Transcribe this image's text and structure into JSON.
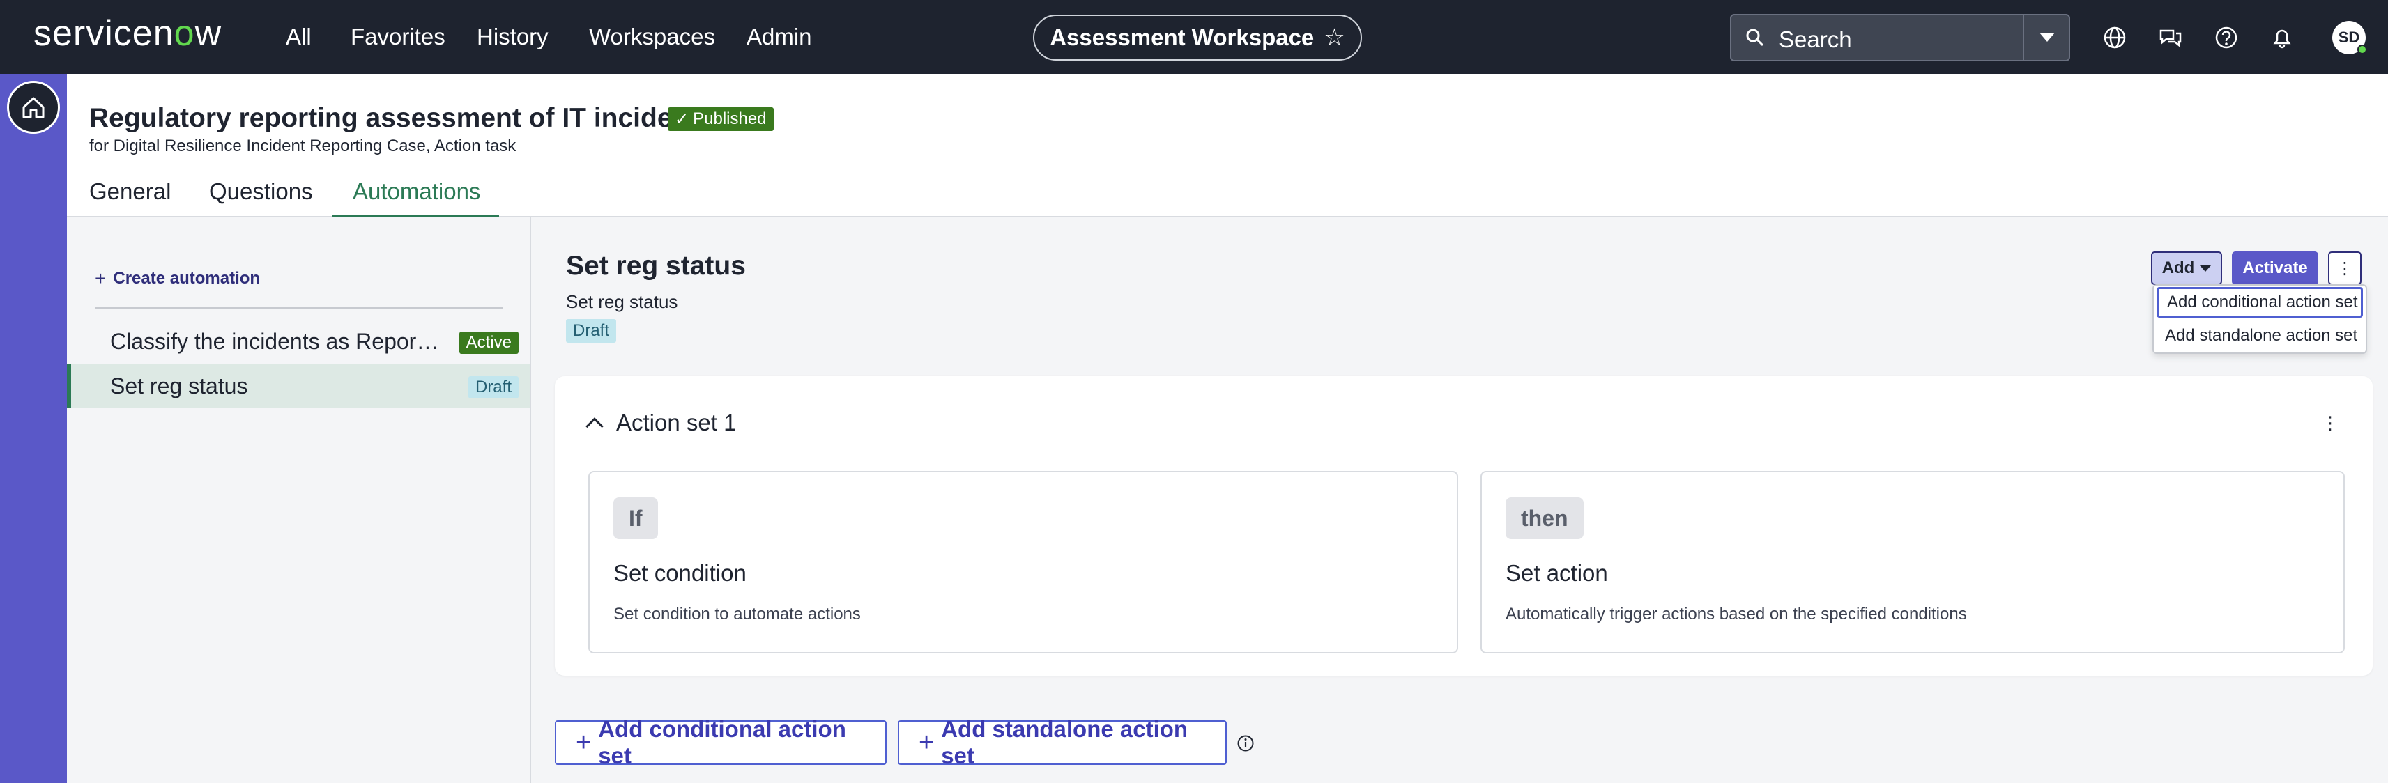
{
  "topnav": {
    "logo_pre": "servicen",
    "logo_o": "o",
    "logo_post": "w",
    "items": [
      "All",
      "Favorites",
      "History",
      "Workspaces",
      "Admin"
    ],
    "workspace_label": "Assessment Workspace",
    "search_placeholder": "Search",
    "avatar_initials": "SD"
  },
  "header": {
    "title": "Regulatory reporting assessment of IT incidents",
    "status_badge": "Published",
    "subtitle": "for Digital Resilience Incident Reporting Case, Action task",
    "tabs": [
      "General",
      "Questions",
      "Automations"
    ],
    "active_tab": "Automations"
  },
  "sidebar": {
    "create_label": "Create automation",
    "items": [
      {
        "name": "Classify the incidents as Repor…",
        "status": "Active"
      },
      {
        "name": "Set reg status",
        "status": "Draft"
      }
    ]
  },
  "main": {
    "title": "Set reg status",
    "subtitle": "Set reg status",
    "status": "Draft",
    "add_label": "Add",
    "activate_label": "Activate",
    "dropdown": [
      "Add conditional action set",
      "Add standalone action set"
    ],
    "action_set": {
      "title": "Action set 1",
      "if_pill": "If",
      "if_title": "Set condition",
      "if_desc": "Set condition to automate actions",
      "then_pill": "then",
      "then_title": "Set action",
      "then_desc": "Automatically trigger actions based on the specified conditions"
    },
    "bottom_buttons": [
      "Add conditional action set",
      "Add standalone action set"
    ]
  },
  "colors": {
    "nav_bg": "#1e232f",
    "rail": "#5a58c8",
    "accent_green": "#2b7a55",
    "published": "#3a7a1e",
    "draft_bg": "#c2e6ee",
    "primary": "#4f5fd1"
  }
}
